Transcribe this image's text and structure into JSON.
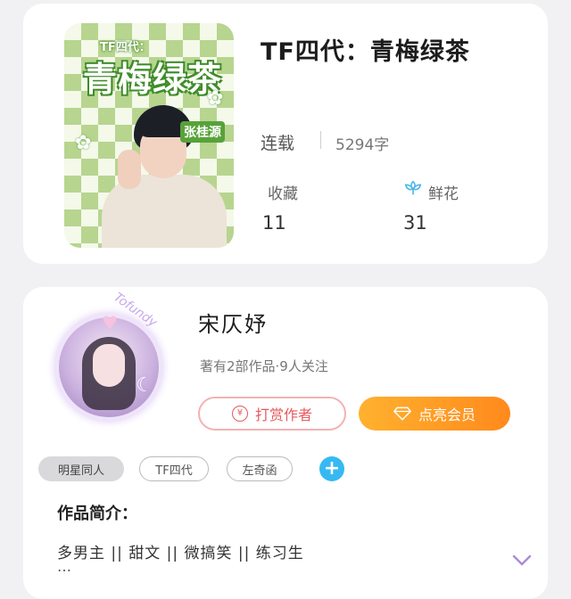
{
  "book": {
    "cover": {
      "small_text": "TF四代：",
      "title_text": "青梅绿茶",
      "author_tag": "张桂源"
    },
    "title": "TF四代：青梅绿茶",
    "status": "连载",
    "word_count": "5294字",
    "favorites_label": "收藏",
    "favorites_count": "11",
    "flowers_label": "鲜花",
    "flowers_count": "31"
  },
  "author": {
    "name": "宋仄妤",
    "meta": "著有2部作品·9人关注",
    "avatar_arc_text": "Tofundy",
    "reward_button": "打赏作者",
    "vip_button": "点亮会员",
    "tags": [
      "明星同人",
      "TF四代",
      "左奇函"
    ]
  },
  "intro": {
    "label": "作品简介：",
    "text": "多男主 || 甜文 || 微搞笑 || 练习生",
    "ellipsis": "…"
  },
  "colors": {
    "accent_orange": "#ff9a26",
    "reward_red": "#e65a5f",
    "add_blue": "#36b9f3",
    "chevron_purple": "#a98bd8"
  }
}
